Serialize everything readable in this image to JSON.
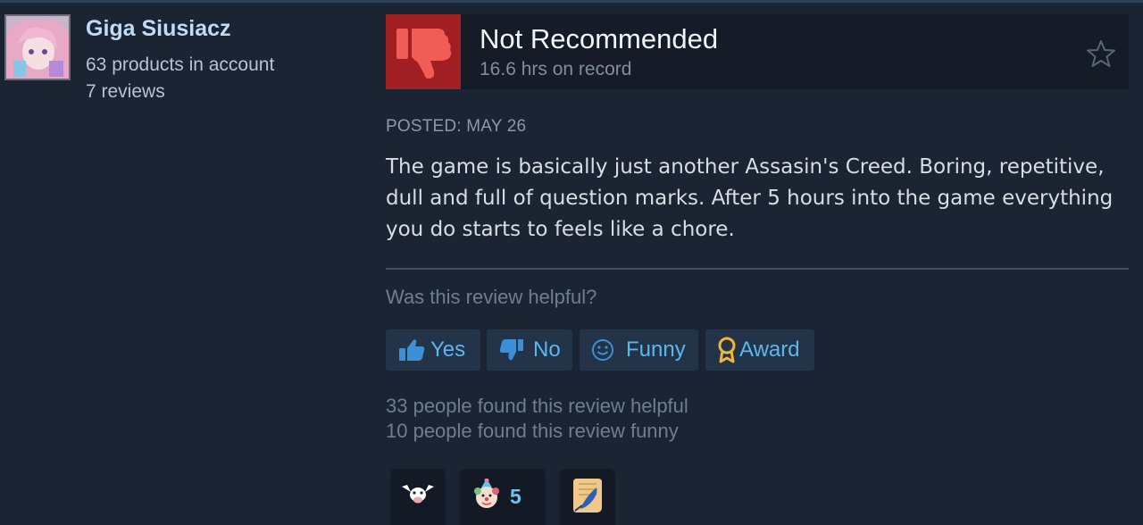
{
  "author": {
    "name": "Giga Siusiacz",
    "products": "63 products in account",
    "reviews": "7 reviews"
  },
  "review": {
    "vote": "Not Recommended",
    "hours": "16.6 hrs on record",
    "posted": "POSTED: MAY 26",
    "text": "The game is basically just another Assasin's Creed. Boring, repetitive, dull and full of question marks. After 5 hours into the game everything you do starts to feels like a chore."
  },
  "helpful": {
    "question": "Was this review helpful?",
    "buttons": {
      "yes": "Yes",
      "no": "No",
      "funny": "Funny",
      "award": "Award"
    },
    "found_helpful": "33 people found this review helpful",
    "found_funny": "10 people found this review funny"
  },
  "awards": [
    {
      "icon": "cow-award-icon"
    },
    {
      "icon": "clown-award-icon",
      "count": "5"
    },
    {
      "icon": "scroll-award-icon"
    }
  ],
  "colors": {
    "not_recommended": "#a11f22",
    "button_text": "#5ab8f0",
    "background": "#1b2433"
  }
}
